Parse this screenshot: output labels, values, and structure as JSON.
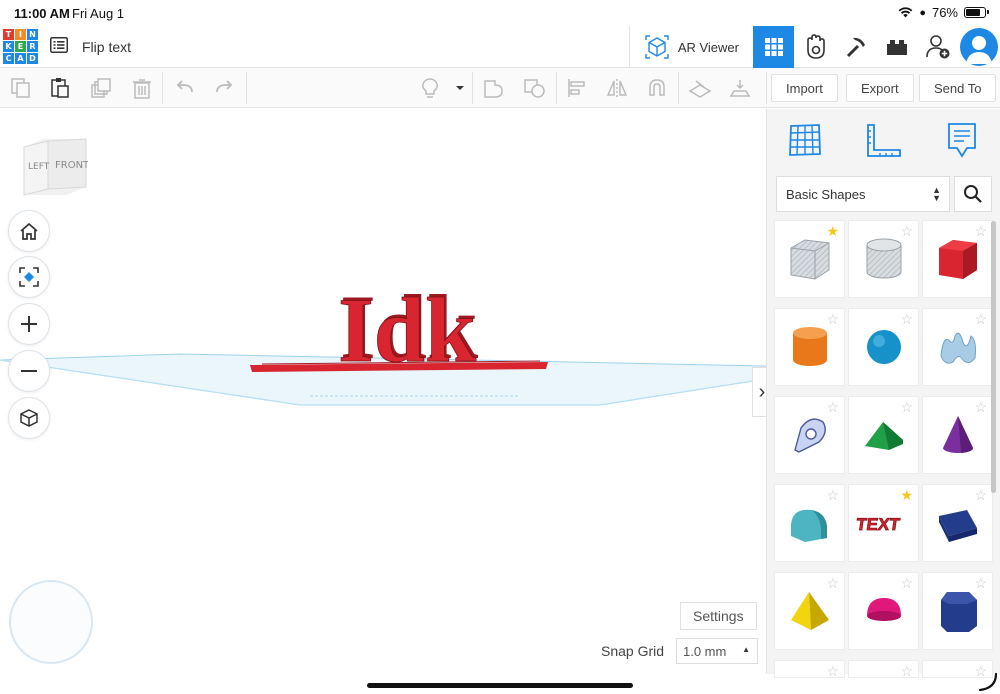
{
  "status_bar": {
    "time": "11:00 AM",
    "date": "Fri Aug 1",
    "battery": "76%",
    "battery_level": 0.76
  },
  "logo": {
    "letters": [
      "T",
      "I",
      "N",
      "K",
      "E",
      "R",
      "C",
      "A",
      "D"
    ],
    "colors": [
      "#e23b2e",
      "#f28c28",
      "#1e88e5",
      "#1e88e5",
      "#2fa84f",
      "#1e88e5",
      "#1e88e5",
      "#1e88e5",
      "#1e88e5"
    ]
  },
  "header": {
    "title": "Flip text",
    "ar_viewer_label": "AR Viewer",
    "views": [
      "3d-design-grid-icon",
      "codeblocks-icon",
      "pickaxe-icon",
      "bricks-icon",
      "add-user-icon"
    ]
  },
  "toolbar": {
    "import_label": "Import",
    "export_label": "Export",
    "send_to_label": "Send To"
  },
  "workspace": {
    "viewcube": {
      "left_face": "LEFT",
      "front_face": "FRONT"
    },
    "scene_text": "Idk",
    "settings_label": "Settings",
    "snap_grid_label": "Snap Grid",
    "snap_grid_value": "1.0 mm",
    "accent_color": "#1e88e5",
    "object_color": "#d9252f"
  },
  "panel": {
    "category": "Basic Shapes",
    "shapes": [
      {
        "name": "Box hole",
        "favorite": true
      },
      {
        "name": "Cylinder hole",
        "favorite": false
      },
      {
        "name": "Box",
        "favorite": false
      },
      {
        "name": "Cylinder",
        "favorite": false
      },
      {
        "name": "Sphere",
        "favorite": false
      },
      {
        "name": "Scribble",
        "favorite": false
      },
      {
        "name": "Shape generator",
        "favorite": false
      },
      {
        "name": "Roof",
        "favorite": false
      },
      {
        "name": "Cone",
        "favorite": false
      },
      {
        "name": "Round roof",
        "favorite": false
      },
      {
        "name": "Text",
        "favorite": true
      },
      {
        "name": "Wedge",
        "favorite": false
      },
      {
        "name": "Pyramid",
        "favorite": false
      },
      {
        "name": "Half sphere",
        "favorite": false
      },
      {
        "name": "Polygon",
        "favorite": false
      },
      {
        "name": "",
        "favorite": false
      },
      {
        "name": "",
        "favorite": false
      },
      {
        "name": "",
        "favorite": false
      }
    ]
  }
}
